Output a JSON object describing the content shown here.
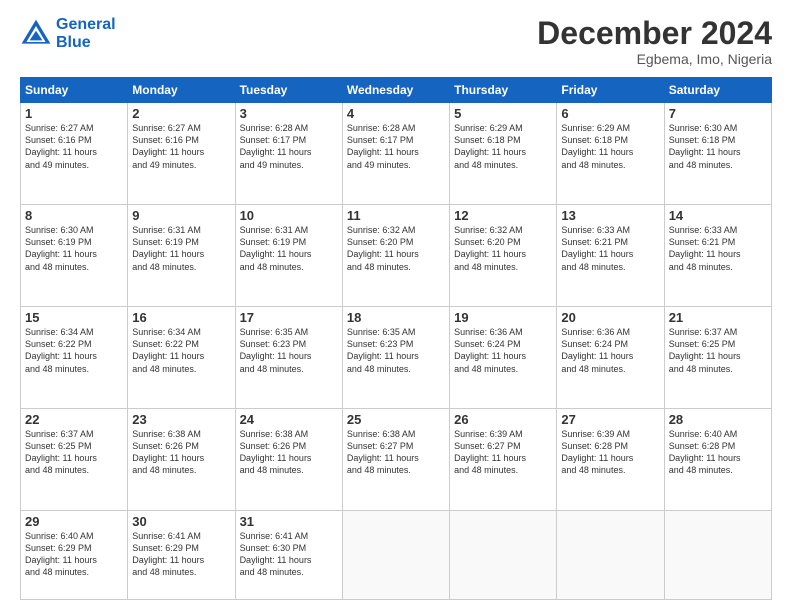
{
  "header": {
    "logo_line1": "General",
    "logo_line2": "Blue",
    "month_title": "December 2024",
    "location": "Egbema, Imo, Nigeria"
  },
  "days_of_week": [
    "Sunday",
    "Monday",
    "Tuesday",
    "Wednesday",
    "Thursday",
    "Friday",
    "Saturday"
  ],
  "weeks": [
    [
      {
        "day": "1",
        "lines": [
          "Sunrise: 6:27 AM",
          "Sunset: 6:16 PM",
          "Daylight: 11 hours",
          "and 49 minutes."
        ]
      },
      {
        "day": "2",
        "lines": [
          "Sunrise: 6:27 AM",
          "Sunset: 6:16 PM",
          "Daylight: 11 hours",
          "and 49 minutes."
        ]
      },
      {
        "day": "3",
        "lines": [
          "Sunrise: 6:28 AM",
          "Sunset: 6:17 PM",
          "Daylight: 11 hours",
          "and 49 minutes."
        ]
      },
      {
        "day": "4",
        "lines": [
          "Sunrise: 6:28 AM",
          "Sunset: 6:17 PM",
          "Daylight: 11 hours",
          "and 49 minutes."
        ]
      },
      {
        "day": "5",
        "lines": [
          "Sunrise: 6:29 AM",
          "Sunset: 6:18 PM",
          "Daylight: 11 hours",
          "and 48 minutes."
        ]
      },
      {
        "day": "6",
        "lines": [
          "Sunrise: 6:29 AM",
          "Sunset: 6:18 PM",
          "Daylight: 11 hours",
          "and 48 minutes."
        ]
      },
      {
        "day": "7",
        "lines": [
          "Sunrise: 6:30 AM",
          "Sunset: 6:18 PM",
          "Daylight: 11 hours",
          "and 48 minutes."
        ]
      }
    ],
    [
      {
        "day": "8",
        "lines": [
          "Sunrise: 6:30 AM",
          "Sunset: 6:19 PM",
          "Daylight: 11 hours",
          "and 48 minutes."
        ]
      },
      {
        "day": "9",
        "lines": [
          "Sunrise: 6:31 AM",
          "Sunset: 6:19 PM",
          "Daylight: 11 hours",
          "and 48 minutes."
        ]
      },
      {
        "day": "10",
        "lines": [
          "Sunrise: 6:31 AM",
          "Sunset: 6:19 PM",
          "Daylight: 11 hours",
          "and 48 minutes."
        ]
      },
      {
        "day": "11",
        "lines": [
          "Sunrise: 6:32 AM",
          "Sunset: 6:20 PM",
          "Daylight: 11 hours",
          "and 48 minutes."
        ]
      },
      {
        "day": "12",
        "lines": [
          "Sunrise: 6:32 AM",
          "Sunset: 6:20 PM",
          "Daylight: 11 hours",
          "and 48 minutes."
        ]
      },
      {
        "day": "13",
        "lines": [
          "Sunrise: 6:33 AM",
          "Sunset: 6:21 PM",
          "Daylight: 11 hours",
          "and 48 minutes."
        ]
      },
      {
        "day": "14",
        "lines": [
          "Sunrise: 6:33 AM",
          "Sunset: 6:21 PM",
          "Daylight: 11 hours",
          "and 48 minutes."
        ]
      }
    ],
    [
      {
        "day": "15",
        "lines": [
          "Sunrise: 6:34 AM",
          "Sunset: 6:22 PM",
          "Daylight: 11 hours",
          "and 48 minutes."
        ]
      },
      {
        "day": "16",
        "lines": [
          "Sunrise: 6:34 AM",
          "Sunset: 6:22 PM",
          "Daylight: 11 hours",
          "and 48 minutes."
        ]
      },
      {
        "day": "17",
        "lines": [
          "Sunrise: 6:35 AM",
          "Sunset: 6:23 PM",
          "Daylight: 11 hours",
          "and 48 minutes."
        ]
      },
      {
        "day": "18",
        "lines": [
          "Sunrise: 6:35 AM",
          "Sunset: 6:23 PM",
          "Daylight: 11 hours",
          "and 48 minutes."
        ]
      },
      {
        "day": "19",
        "lines": [
          "Sunrise: 6:36 AM",
          "Sunset: 6:24 PM",
          "Daylight: 11 hours",
          "and 48 minutes."
        ]
      },
      {
        "day": "20",
        "lines": [
          "Sunrise: 6:36 AM",
          "Sunset: 6:24 PM",
          "Daylight: 11 hours",
          "and 48 minutes."
        ]
      },
      {
        "day": "21",
        "lines": [
          "Sunrise: 6:37 AM",
          "Sunset: 6:25 PM",
          "Daylight: 11 hours",
          "and 48 minutes."
        ]
      }
    ],
    [
      {
        "day": "22",
        "lines": [
          "Sunrise: 6:37 AM",
          "Sunset: 6:25 PM",
          "Daylight: 11 hours",
          "and 48 minutes."
        ]
      },
      {
        "day": "23",
        "lines": [
          "Sunrise: 6:38 AM",
          "Sunset: 6:26 PM",
          "Daylight: 11 hours",
          "and 48 minutes."
        ]
      },
      {
        "day": "24",
        "lines": [
          "Sunrise: 6:38 AM",
          "Sunset: 6:26 PM",
          "Daylight: 11 hours",
          "and 48 minutes."
        ]
      },
      {
        "day": "25",
        "lines": [
          "Sunrise: 6:38 AM",
          "Sunset: 6:27 PM",
          "Daylight: 11 hours",
          "and 48 minutes."
        ]
      },
      {
        "day": "26",
        "lines": [
          "Sunrise: 6:39 AM",
          "Sunset: 6:27 PM",
          "Daylight: 11 hours",
          "and 48 minutes."
        ]
      },
      {
        "day": "27",
        "lines": [
          "Sunrise: 6:39 AM",
          "Sunset: 6:28 PM",
          "Daylight: 11 hours",
          "and 48 minutes."
        ]
      },
      {
        "day": "28",
        "lines": [
          "Sunrise: 6:40 AM",
          "Sunset: 6:28 PM",
          "Daylight: 11 hours",
          "and 48 minutes."
        ]
      }
    ],
    [
      {
        "day": "29",
        "lines": [
          "Sunrise: 6:40 AM",
          "Sunset: 6:29 PM",
          "Daylight: 11 hours",
          "and 48 minutes."
        ]
      },
      {
        "day": "30",
        "lines": [
          "Sunrise: 6:41 AM",
          "Sunset: 6:29 PM",
          "Daylight: 11 hours",
          "and 48 minutes."
        ]
      },
      {
        "day": "31",
        "lines": [
          "Sunrise: 6:41 AM",
          "Sunset: 6:30 PM",
          "Daylight: 11 hours",
          "and 48 minutes."
        ]
      },
      null,
      null,
      null,
      null
    ]
  ]
}
